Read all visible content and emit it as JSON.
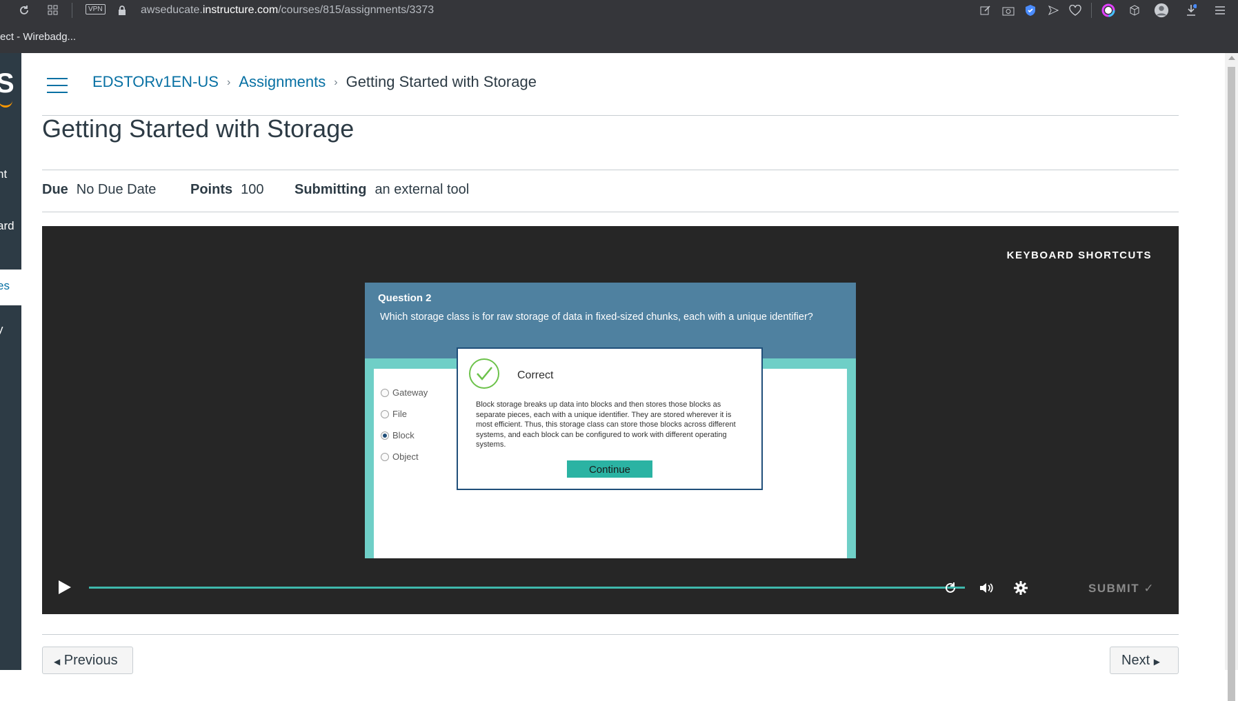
{
  "browser": {
    "url_prefix": "awseducate.",
    "url_domain": "instructure.com",
    "url_path": "/courses/815/assignments/3373",
    "vpn_label": "VPN",
    "bookmark_label": "ect - Wirebadg..."
  },
  "left_nav": {
    "logo": "S",
    "items": [
      "",
      "nt",
      "ard",
      "es",
      "y"
    ]
  },
  "breadcrumb": {
    "course": "EDSTORv1EN-US",
    "section": "Assignments",
    "current": "Getting Started with Storage"
  },
  "page_title": "Getting Started with Storage",
  "meta": {
    "due_label": "Due",
    "due_value": "No Due Date",
    "points_label": "Points",
    "points_value": "100",
    "submitting_label": "Submitting",
    "submitting_value": "an external tool"
  },
  "player": {
    "keyboard_shortcuts": "KEYBOARD SHORTCUTS",
    "question_number": "Question 2",
    "question_text": "Which storage class is for raw storage of data in fixed-sized chunks, each with a unique identifier?",
    "options": [
      "Gateway",
      "File",
      "Block",
      "Object"
    ],
    "selected_option": "Block",
    "feedback_title": "Correct",
    "feedback_text": "Block storage breaks up data into blocks and then stores those blocks as separate pieces, each with a unique identifier. They are stored wherever it is most efficient. Thus, this storage class can store those blocks across different systems, and each block can be configured to work with different operating systems.",
    "continue_label": "Continue",
    "submit_label": "SUBMIT",
    "progress_fraction": 1.0
  },
  "nav_buttons": {
    "previous": "Previous",
    "next": "Next"
  },
  "colors": {
    "link": "#0770a3",
    "canvas_nav": "#2d3b45",
    "player_bg": "#262626",
    "question_header": "#4f81a0",
    "teal": "#6fcfc7",
    "continue_button": "#2bb3a3",
    "check_green": "#6cc24a"
  }
}
